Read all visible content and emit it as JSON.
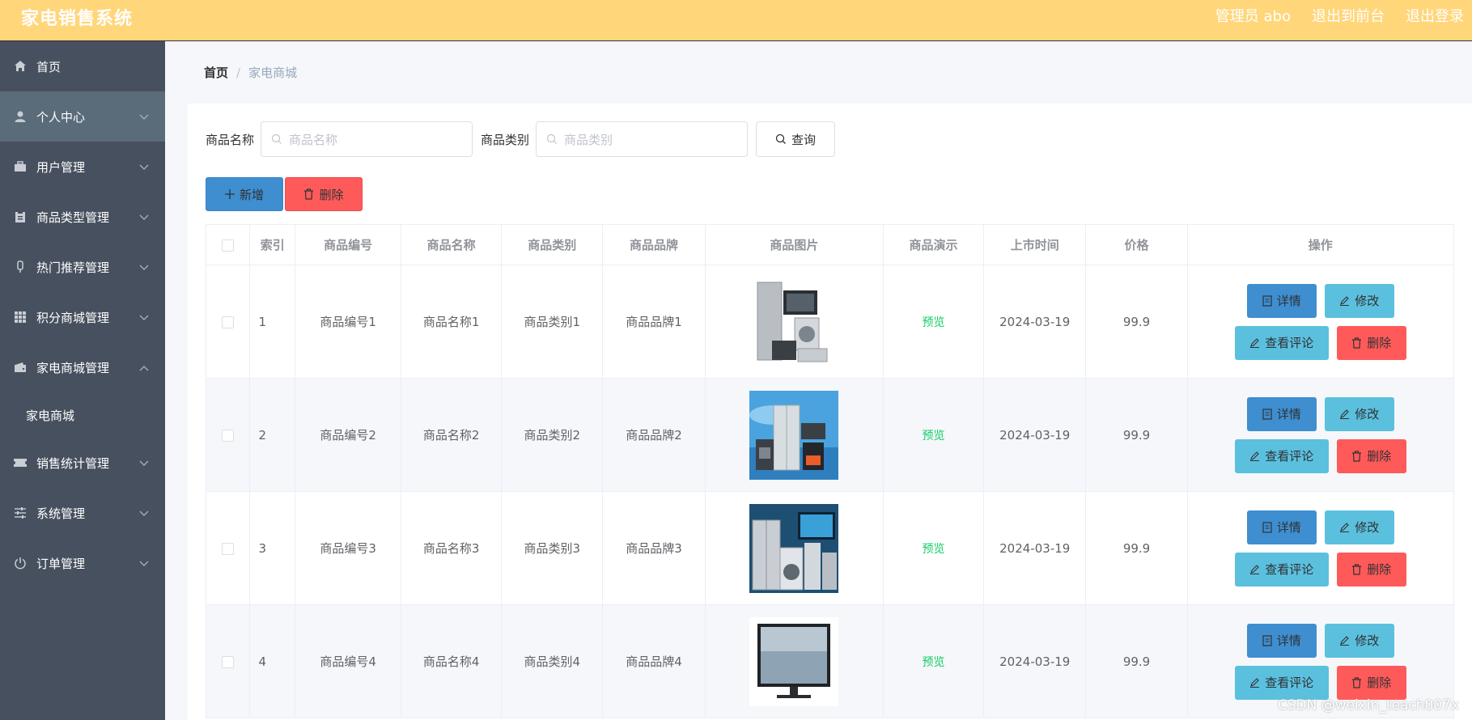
{
  "header": {
    "title": "家电销售系统",
    "admin_label": "管理员 abo",
    "to_front": "退出到前台",
    "logout": "退出登录"
  },
  "sidebar": {
    "items": [
      {
        "label": "首页",
        "icon": "home-icon"
      },
      {
        "label": "个人中心",
        "icon": "user-icon"
      },
      {
        "label": "用户管理",
        "icon": "briefcase-icon"
      },
      {
        "label": "商品类型管理",
        "icon": "clipboard-icon"
      },
      {
        "label": "热门推荐管理",
        "icon": "mic-icon"
      },
      {
        "label": "积分商城管理",
        "icon": "grid-icon"
      },
      {
        "label": "家电商城管理",
        "icon": "wallet-icon"
      },
      {
        "label": "销售统计管理",
        "icon": "ticket-icon"
      },
      {
        "label": "系统管理",
        "icon": "sliders-icon"
      },
      {
        "label": "订单管理",
        "icon": "power-icon"
      }
    ],
    "submenu": {
      "label": "家电商城"
    }
  },
  "breadcrumb": {
    "home": "首页",
    "sep": "/",
    "current": "家电商城"
  },
  "search": {
    "name_label": "商品名称",
    "name_placeholder": "商品名称",
    "category_label": "商品类别",
    "category_placeholder": "商品类别",
    "query_button": "查询"
  },
  "actions": {
    "add": "新增",
    "delete": "删除"
  },
  "table": {
    "headers": [
      "索引",
      "商品编号",
      "商品名称",
      "商品类别",
      "商品品牌",
      "商品图片",
      "商品演示",
      "上市时间",
      "价格",
      "操作"
    ],
    "rows": [
      {
        "index": "1",
        "code": "商品编号1",
        "name": "商品名称1",
        "category": "商品类别1",
        "brand": "商品品牌1",
        "preview": "预览",
        "date": "2024-03-19",
        "price": "99.9"
      },
      {
        "index": "2",
        "code": "商品编号2",
        "name": "商品名称2",
        "category": "商品类别2",
        "brand": "商品品牌2",
        "preview": "预览",
        "date": "2024-03-19",
        "price": "99.9"
      },
      {
        "index": "3",
        "code": "商品编号3",
        "name": "商品名称3",
        "category": "商品类别3",
        "brand": "商品品牌3",
        "preview": "预览",
        "date": "2024-03-19",
        "price": "99.9"
      },
      {
        "index": "4",
        "code": "商品编号4",
        "name": "商品名称4",
        "category": "商品类别4",
        "brand": "商品品牌4",
        "preview": "预览",
        "date": "2024-03-19",
        "price": "99.9"
      }
    ],
    "row_actions": {
      "detail": "详情",
      "edit": "修改",
      "review": "查看评论",
      "delete": "删除"
    }
  },
  "watermark": "CSDN @weixin_teach007x",
  "colors": {
    "header": "#ffd67a",
    "sidebar": "#47505e",
    "primary": "#3e8ed0",
    "info": "#5bc0de",
    "danger": "#ff5a5a",
    "preview": "#13ce66"
  }
}
